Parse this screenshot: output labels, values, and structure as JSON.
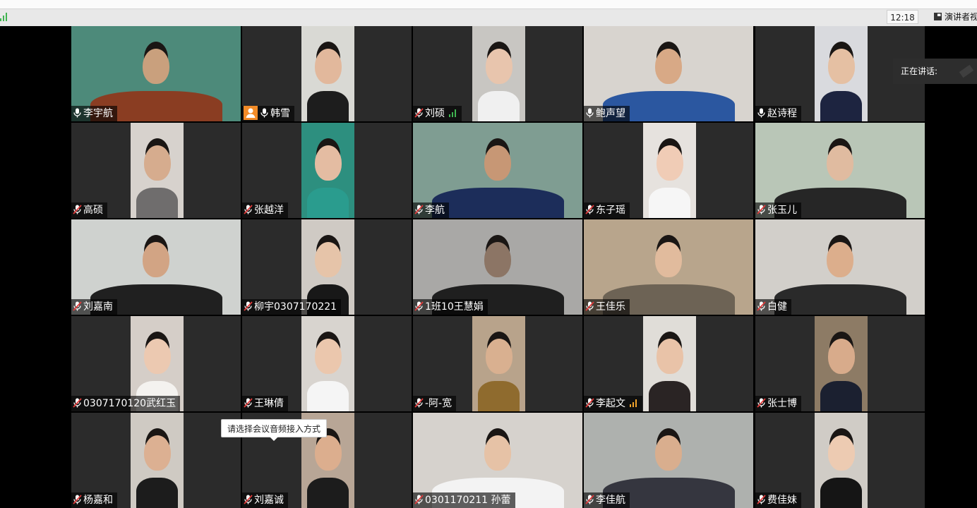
{
  "header": {
    "time": "12:18",
    "view_button_label": "演讲者视"
  },
  "speaking_panel": {
    "label": "正在讲话:"
  },
  "tooltip": {
    "text": "请选择会议音频接入方式"
  },
  "colors": {
    "toolbar_bg": "#e8e8e8",
    "tile_bg": "#2b2b2b",
    "muted_mic": "#e03b3b",
    "host_badge": "#f28c28",
    "signal_green": "#3fb450",
    "signal_orange": "#f2a32b"
  },
  "participants": [
    {
      "name": "李宇航",
      "muted": false,
      "host": false
    },
    {
      "name": "韩雪",
      "muted": false,
      "host": true
    },
    {
      "name": "刘硕",
      "muted": true,
      "host": false,
      "signal": "green"
    },
    {
      "name": "鲍声望",
      "muted": false,
      "host": false
    },
    {
      "name": "赵诗程",
      "muted": false,
      "host": false
    },
    {
      "name": "高硕",
      "muted": true,
      "host": false
    },
    {
      "name": "张越洋",
      "muted": true,
      "host": false
    },
    {
      "name": "李航",
      "muted": true,
      "host": false
    },
    {
      "name": "东子瑶",
      "muted": true,
      "host": false
    },
    {
      "name": "张玉儿",
      "muted": true,
      "host": false
    },
    {
      "name": "刘嘉南",
      "muted": true,
      "host": false
    },
    {
      "name": "柳宇0307170221",
      "muted": true,
      "host": false
    },
    {
      "name": "1班10王慧娟",
      "muted": true,
      "host": false
    },
    {
      "name": "王佳乐",
      "muted": true,
      "host": false
    },
    {
      "name": "白健",
      "muted": true,
      "host": false
    },
    {
      "name": "0307170120武红玉",
      "muted": true,
      "host": false
    },
    {
      "name": "王琳倩",
      "muted": true,
      "host": false
    },
    {
      "name": "-阿-宽",
      "muted": true,
      "host": false
    },
    {
      "name": "李起文",
      "muted": true,
      "host": false,
      "signal": "orange"
    },
    {
      "name": "张士博",
      "muted": true,
      "host": false
    },
    {
      "name": "杨嘉和",
      "muted": true,
      "host": false
    },
    {
      "name": "刘嘉诚",
      "muted": true,
      "host": false
    },
    {
      "name": "0301170211 孙蕾",
      "muted": true,
      "host": false
    },
    {
      "name": "李佳航",
      "muted": true,
      "host": false
    },
    {
      "name": "费佳妹",
      "muted": true,
      "host": false
    }
  ]
}
